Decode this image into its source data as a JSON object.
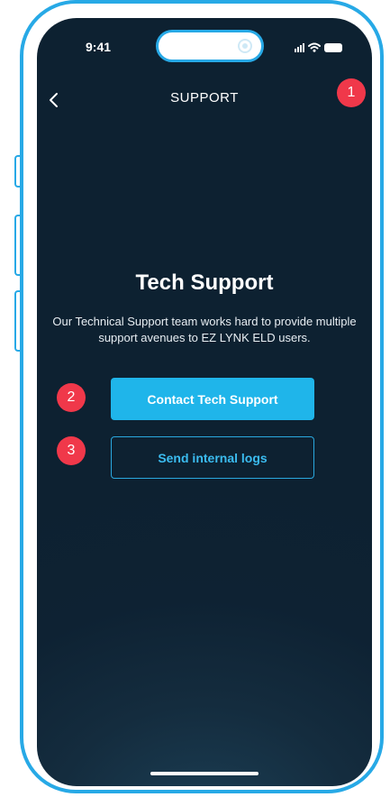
{
  "status_bar": {
    "time": "9:41"
  },
  "nav": {
    "back_icon": "chevron-left-icon",
    "title": "SUPPORT"
  },
  "content": {
    "heading": "Tech Support",
    "description": "Our Technical Support team works hard to provide multiple support avenues to EZ LYNK ELD users.",
    "primary_button": "Contact Tech Support",
    "secondary_button": "Send internal logs"
  },
  "annotations": {
    "marker_1": "1",
    "marker_2": "2",
    "marker_3": "3"
  },
  "colors": {
    "frame": "#27a9e6",
    "background": "#0d2131",
    "accent": "#1fb5ea",
    "marker": "#f0384a"
  }
}
